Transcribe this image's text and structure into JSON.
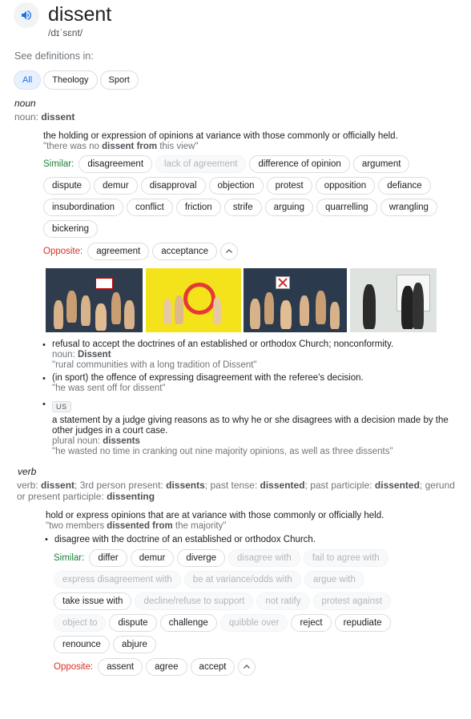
{
  "header": {
    "word": "dissent",
    "phonetic": "/dɪˈsɛnt/",
    "see_definitions": "See definitions in:",
    "filters": [
      "All",
      "Theology",
      "Sport"
    ]
  },
  "noun": {
    "pos": "noun",
    "sub_prefix": "noun: ",
    "sub_word": "dissent",
    "def1": {
      "text": "the holding or expression of opinions at variance with those commonly or officially held.",
      "ex_pre": "\"there was no ",
      "ex_bold": "dissent from",
      "ex_post": " this view\""
    },
    "similar_label": "Similar:",
    "similar": [
      "disagreement",
      "lack of agreement",
      "difference of opinion",
      "argument",
      "dispute",
      "demur",
      "disapproval",
      "objection",
      "protest",
      "opposition",
      "defiance",
      "insubordination",
      "conflict",
      "friction",
      "strife",
      "arguing",
      "quarrelling",
      "wrangling",
      "bickering"
    ],
    "opposite_label": "Opposite:",
    "opposite": [
      "agreement",
      "acceptance"
    ],
    "def2": {
      "text": "refusal to accept the doctrines of an established or orthodox Church; nonconformity.",
      "sub_prefix": "noun: ",
      "sub_word": "Dissent",
      "ex": "\"rural communities with a long tradition of Dissent\""
    },
    "def3": {
      "text": "(in sport) the offence of expressing disagreement with the referee's decision.",
      "ex": "\"he was sent off for dissent\""
    },
    "def4": {
      "tag": "US",
      "text": "a statement by a judge giving reasons as to why he or she disagrees with a decision made by the other judges in a court case.",
      "sub_prefix": "plural noun: ",
      "sub_word": "dissents",
      "ex": "\"he wasted no time in cranking out nine majority opinions, as well as three dissents\""
    }
  },
  "verb": {
    "pos": "verb",
    "forms": {
      "p1": "verb: ",
      "w1": "dissent",
      "p2": "; 3rd person present: ",
      "w2": "dissents",
      "p3": "; past tense: ",
      "w3": "dissented",
      "p4": "; past participle: ",
      "w4": "dissented",
      "p5": "; gerund or present participle: ",
      "w5": "dissenting"
    },
    "def1": {
      "text": "hold or express opinions that are at variance with those commonly or officially held.",
      "ex_pre": "\"two members ",
      "ex_bold": "dissented from",
      "ex_post": " the majority\""
    },
    "def2": {
      "text": "disagree with the doctrine of an established or orthodox Church."
    },
    "similar_label": "Similar:",
    "similar": [
      "differ",
      "demur",
      "diverge",
      "disagree with",
      "fail to agree with",
      "express disagreement with",
      "be at variance/odds with",
      "argue with",
      "take issue with",
      "decline/refuse to support",
      "not ratify",
      "protest against",
      "object to",
      "dispute",
      "challenge",
      "quibble over",
      "reject",
      "repudiate",
      "renounce",
      "abjure"
    ],
    "opposite_label": "Opposite:",
    "opposite": [
      "assent",
      "agree",
      "accept"
    ]
  },
  "colors": {
    "accent": "#1a73e8",
    "similar": "#188038",
    "opposite": "#d93025"
  },
  "icons": {
    "speaker": "speaker-icon",
    "expand": "chevron-up-icon"
  }
}
